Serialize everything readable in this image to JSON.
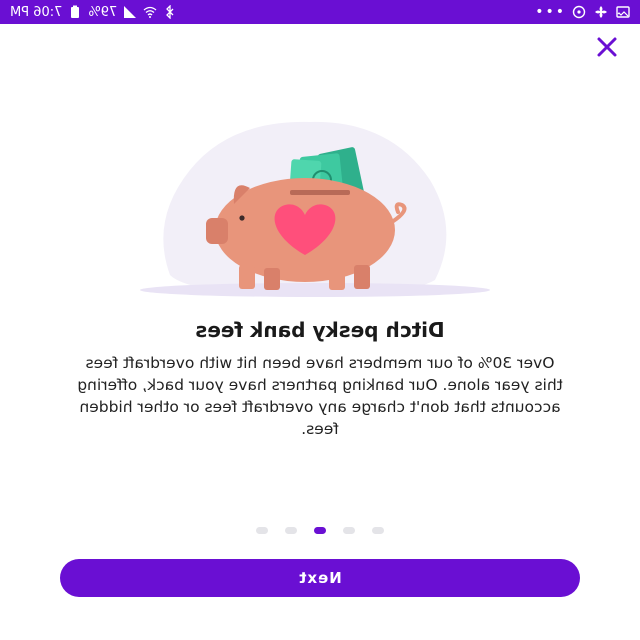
{
  "status_bar": {
    "time": "7:06 PM",
    "battery": "79%",
    "more": "•••",
    "icons_left": [
      "image-icon",
      "fan-icon",
      "clock-icon"
    ],
    "icons_right": [
      "battery-icon",
      "wifi-icon",
      "bluetooth-icon"
    ]
  },
  "close_icon": "close-icon",
  "onboarding": {
    "title": "Ditch pesky bank fees",
    "body": "Over 30% of our members have been hit with overdraft fees this year alone. Our banking partners have your back, offering accounts that don't charge any overdraft fees or other hidden fees.",
    "page_count": 5,
    "current_page": 3,
    "next_label": "Next"
  },
  "colors": {
    "accent": "#6a0fd3",
    "piggy": "#e8957b",
    "heart": "#ff4f7b",
    "money": "#3ec9a0"
  }
}
